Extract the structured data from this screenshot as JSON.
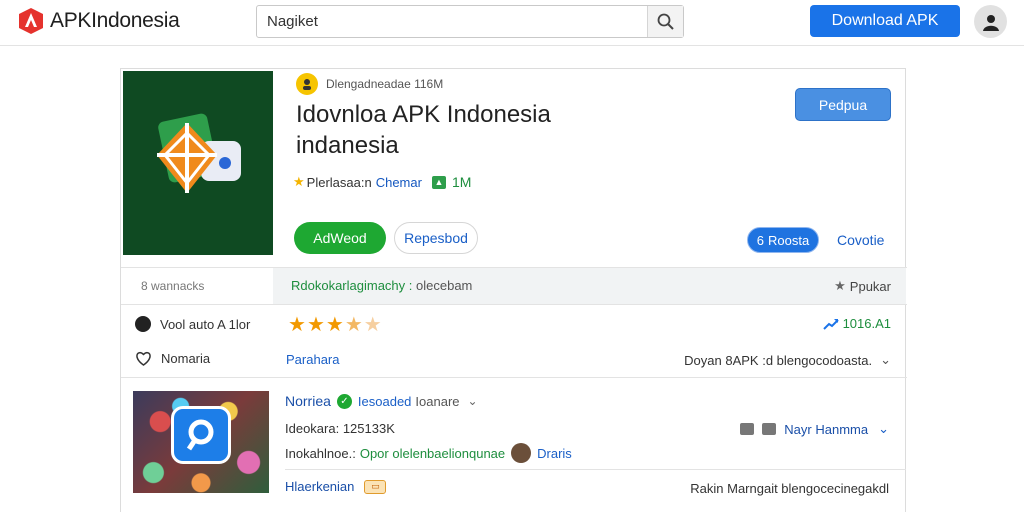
{
  "header": {
    "logo_text": "APKIndonesia",
    "search_value": "Nagiket",
    "download_button": "Download APK",
    "brand_color": "#1a73e8"
  },
  "app": {
    "developer_line": "Dlengadneadae 116M",
    "title_line1": "Idovnloa APK Indonesia",
    "title_line2": "indanesia",
    "meta_category": "Plerlasaa:n",
    "meta_owner": "Chemar",
    "meta_count": "1M",
    "install_button": "AdWeod",
    "secondary_button": "Repesbod",
    "popular_button": "Pedpua",
    "pill_button": "Roosta",
    "console_link": "Covotie"
  },
  "info_rows": {
    "downloads_label": "8 wannacks",
    "highlight_green": "Rdokokarlagimachy :",
    "highlight_gray": "olecebam",
    "popular_label": "Ppukar",
    "version_label": "Vool auto A 1lor",
    "rating_stars": 3.5,
    "trend_value": "1016.A1",
    "favorite_label": "Nomaria",
    "mid_link": "Parahara",
    "right_text": "Doyan 8APK :d blengocodoasta."
  },
  "second_app": {
    "name": "Norriea",
    "tag": "Iesoaded",
    "tag2": "Ioanare",
    "size": "Ideokara: 125133K",
    "dev_prefix": "Inokahlnoe.:",
    "dev_green": "Opor olelenbaelionqunae",
    "dev_name": "Draris",
    "right_label": "Nayr Hanmma",
    "bottom_left": "Hlaerkenian",
    "bottom_right": "Rakin Marngait blengocecinegakdl"
  },
  "icons": {
    "search": "search-icon",
    "avatar": "user-icon",
    "star": "star-icon",
    "heart": "heart-icon",
    "clock": "clock-icon",
    "chevron": "chevron-down-icon",
    "lock": "lock-icon",
    "trend": "trend-arrow-icon"
  }
}
